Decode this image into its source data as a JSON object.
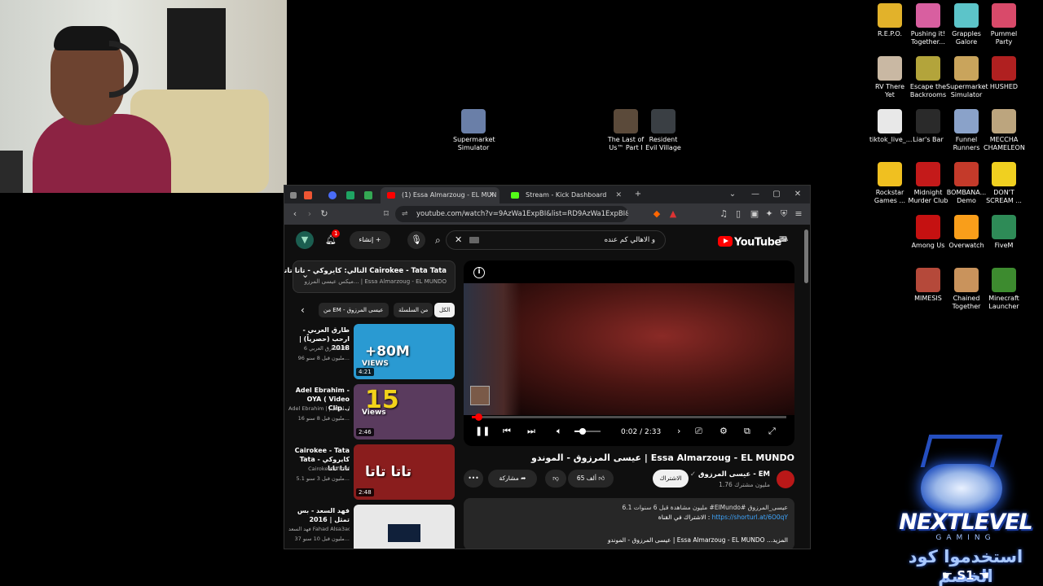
{
  "desktop": {
    "left_icons": [
      {
        "label": "Supermarket Simulator",
        "color": "#6a7fa8"
      },
      {
        "label": "The Last of Us™ Part I",
        "color": "#5b4a3a"
      },
      {
        "label": "Resident Evil Village",
        "color": "#3a3f44"
      }
    ],
    "right_icons": [
      {
        "label": "R.E.P.O.",
        "color": "#e2b22a"
      },
      {
        "label": "Pushing it! Together...",
        "color": "#d85fa0"
      },
      {
        "label": "Grapples Galore",
        "color": "#5cc4c9"
      },
      {
        "label": "Pummel Party",
        "color": "#d94a6a"
      },
      {
        "label": "RV There Yet",
        "color": "#c9b8a3"
      },
      {
        "label": "Escape the Backrooms",
        "color": "#b3a43b"
      },
      {
        "label": "Supermarket Simulator",
        "color": "#c9a45c"
      },
      {
        "label": "HUSHED",
        "color": "#b02020"
      },
      {
        "label": "tiktok_live_...",
        "color": "#e8e8e8"
      },
      {
        "label": "Liar's Bar",
        "color": "#2a2a2a"
      },
      {
        "label": "Funnel Runners",
        "color": "#8aa2c9"
      },
      {
        "label": "MECCHA CHAMELEON",
        "color": "#bca57e"
      },
      {
        "label": "Rockstar Games ...",
        "color": "#f0c020"
      },
      {
        "label": "Midnight Murder Club",
        "color": "#c41a1a"
      },
      {
        "label": "BOMBANA... Demo",
        "color": "#c43a2a"
      },
      {
        "label": "DON'T SCREAM ...",
        "color": "#f0d020"
      },
      {
        "label": "Among Us",
        "color": "#c51111"
      },
      {
        "label": "Overwatch",
        "color": "#f99e1a"
      },
      {
        "label": "FiveM",
        "color": "#2e8b57"
      },
      {
        "label": "MIMESIS",
        "color": "#b5493a"
      },
      {
        "label": "Chained Together",
        "color": "#c9935c"
      },
      {
        "label": "Minecraft Launcher",
        "color": "#3d8b2f"
      }
    ]
  },
  "browser": {
    "tabs": [
      {
        "label": "(1) Essa Almarzoug - EL MUN",
        "active": true,
        "icon_color": "#ff0000"
      },
      {
        "label": "Stream - Kick Dashboard",
        "active": false,
        "icon_color": "#53fc18"
      }
    ],
    "url": "youtube.com/watch?v=9AzWa1ExpBI&list=RD9AzWa1ExpBI&st...",
    "window_buttons": [
      "⌄",
      "—",
      "▢",
      "✕"
    ]
  },
  "youtube": {
    "logo": "YouTube",
    "logo_country": "SA",
    "search_query": "و الاهالي كم عنده",
    "create_label": "إنشاء",
    "notification_count": "1",
    "playlist": {
      "up_next": "التالي: كايروكي - تاتا تاتا Cairokee - Tata Tata",
      "mix_info": "ميكس عيسى المرزو... | Essa Almarzoug - EL MUNDO",
      "chips": [
        "الكل",
        "من السلسلة",
        "من EM - عيسى المرزوق"
      ],
      "items": [
        {
          "title": "طارق العربي - ارحب (حصرياً) | 2018",
          "channel": "طارق العربي 6ar8o",
          "meta": "96 مليون  قبل 8 سنو...",
          "duration": "4:21",
          "thumb_text": "+80M",
          "thumb_sub": "VIEWS",
          "thumb_color": "#2a9ad2"
        },
        {
          "title": "Adel Ebrahim - OYA ( Video Clip...",
          "channel": "Adel Ebrahim | عادل ابراهيم",
          "meta": "16 مليون  قبل 8 سنو...",
          "duration": "2:46",
          "thumb_text": "15",
          "thumb_sub": "Views",
          "thumb_color": "#5a3b5e"
        },
        {
          "title": "Cairokee - Tata Tata كايروكي - تاتا تاتا",
          "channel": "CairokeeOfficial",
          "meta": "5.1 مليون  قبل 3 سنو...",
          "duration": "2:48",
          "thumb_text": "تاتا تاتا",
          "thumb_sub": "",
          "thumb_color": "#8a1d1d"
        },
        {
          "title": "فهد السعد - بس تمثل | 2016",
          "channel": "فهد السعد Fahad Alsa3ad...",
          "meta": "37 مليون  قبل 10 سنو...",
          "duration": "",
          "thumb_text": "",
          "thumb_sub": "",
          "thumb_color": "#e8e8e8"
        }
      ]
    },
    "player": {
      "current_time": "0:02",
      "duration": "2:33",
      "progress_fraction": 0.013,
      "volume_fraction": 0.3
    },
    "video": {
      "title": "عيسى المرزوق - الموندو | Essa Almarzoug - EL MUNDO",
      "channel_name": "عيسى المرزوق - EM",
      "subscribers": "1.76 مليون مشترك",
      "subscribe_label": "الاشتراك",
      "likes": "65 ألف",
      "share_label": "مشاركة",
      "description_stats": "6.1 مليون مشاهدة  قبل 6 سنوات  #ElMundo# عيسى_المرزوق",
      "description_link_prefix": "الاشتراك في القناة :",
      "description_link": "https://shorturl.at/6O0qY",
      "description_line3": "عيسى المرزوق - الموندو | Essa Almarzoug - EL MUNDO ...المزيد"
    }
  },
  "overlay": {
    "brand": "NEXTLEVEL",
    "brand_sub": "GAMING",
    "promo_text": "استخدموا كود الخصم",
    "promo_code": "S1"
  }
}
